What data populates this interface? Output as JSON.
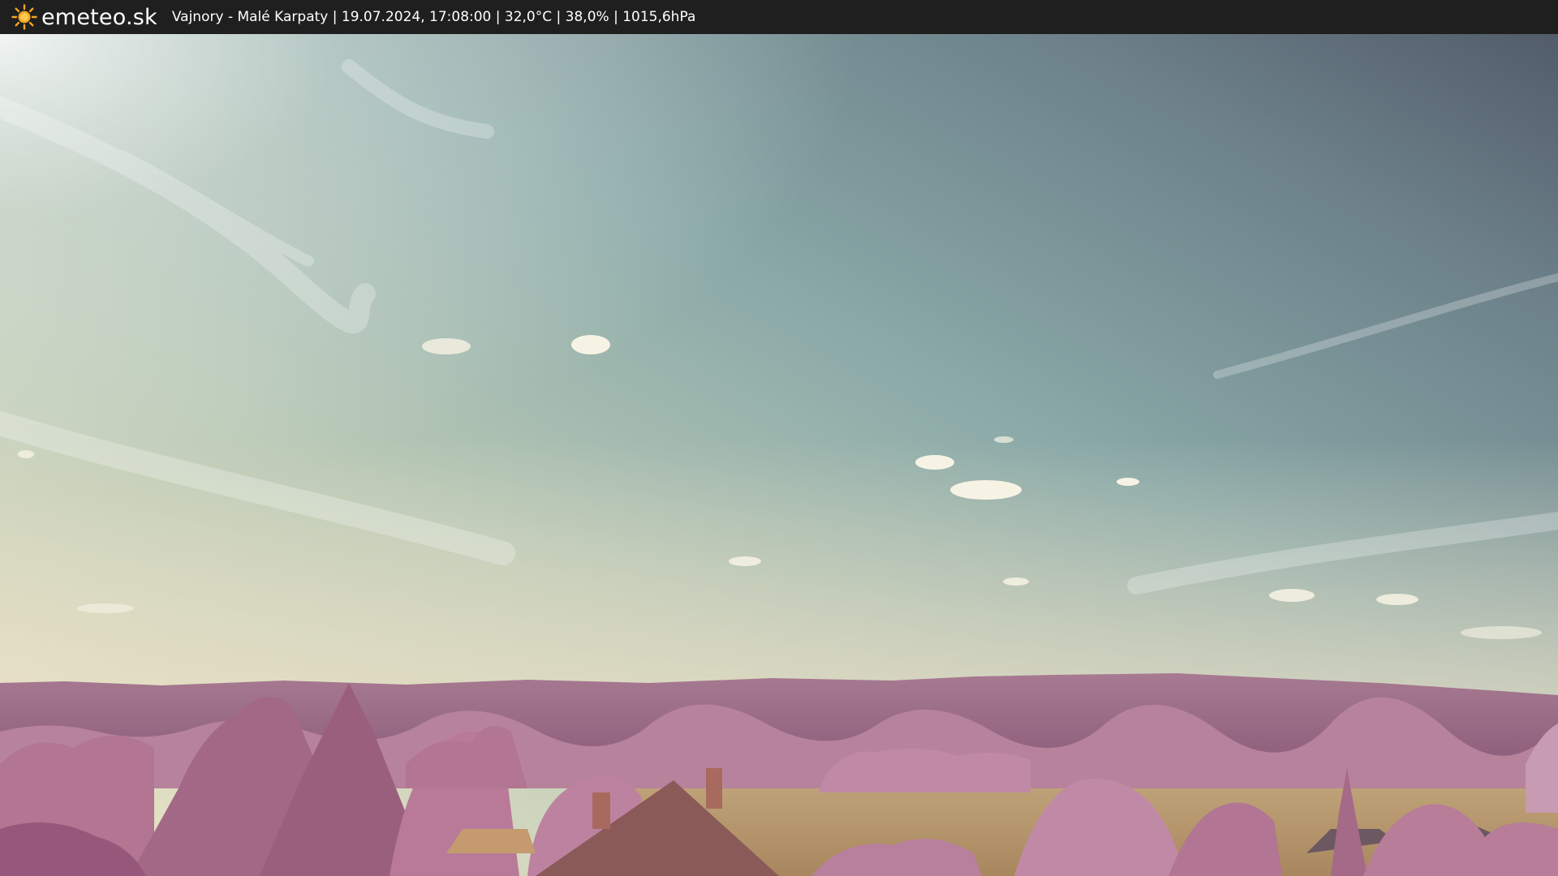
{
  "header": {
    "logo_text": "emeteo.sk",
    "logo_icon": "sun-icon",
    "status_text": "Vajnory - Malé Karpaty | 19.07.2024, 17:08:00 | 32,0°C | 38,0% | 1015,6hPa"
  },
  "webcam": {
    "content": "infrared-sky-landscape-image"
  },
  "colors": {
    "topbar": "#1f1f1f",
    "logo_text": "#ffffff",
    "sun": "#f5a623",
    "sky_top_right": "#55606f",
    "sky_mid": "#8fb1b0",
    "sky_horizon": "#e6e3c8",
    "foliage": "#b87896",
    "hills": "#9a6a86",
    "field": "#b89a72"
  }
}
